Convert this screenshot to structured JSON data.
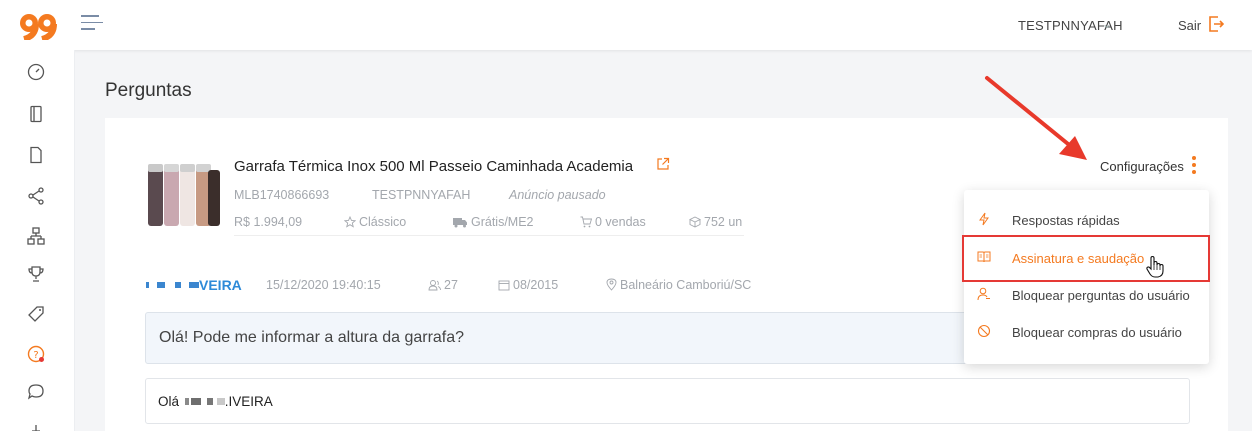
{
  "header": {
    "username": "TESTPNNYAFAH",
    "logout_label": "Sair",
    "chevron": "⌄"
  },
  "page": {
    "title": "Perguntas"
  },
  "product": {
    "title": "Garrafa Térmica Inox 500 Ml Passeio Caminhada Academia",
    "id": "MLB1740866693",
    "seller": "TESTPNNYAFAH",
    "status": "Anúncio pausado",
    "price": "R$ 1.994,09",
    "listing_type": "Clássico",
    "shipping": "Grátis/ME2",
    "sales": "0 vendas",
    "stock": "752 un"
  },
  "config": {
    "label": "Configurações",
    "menu": [
      {
        "label": "Respostas rápidas",
        "icon": "lightning-icon"
      },
      {
        "label": "Assinatura e saudação",
        "icon": "book-icon"
      },
      {
        "label": "Bloquear perguntas do usuário",
        "icon": "user-block-icon"
      },
      {
        "label": "Bloquear compras do usuário",
        "icon": "block-icon"
      }
    ]
  },
  "question": {
    "asker": "VEIRA",
    "datetime": "15/12/2020 19:40:15",
    "points": "27",
    "since": "08/2015",
    "location": "Balneário Camboriú/SC",
    "text": "Olá! Pode me informar a altura da garrafa?"
  },
  "answer": {
    "prefix": "Olá",
    "suffix": ".IVEIRA"
  },
  "colors": {
    "accent": "#f47a20",
    "link": "#2d8ad8",
    "highlight": "#e53935"
  }
}
